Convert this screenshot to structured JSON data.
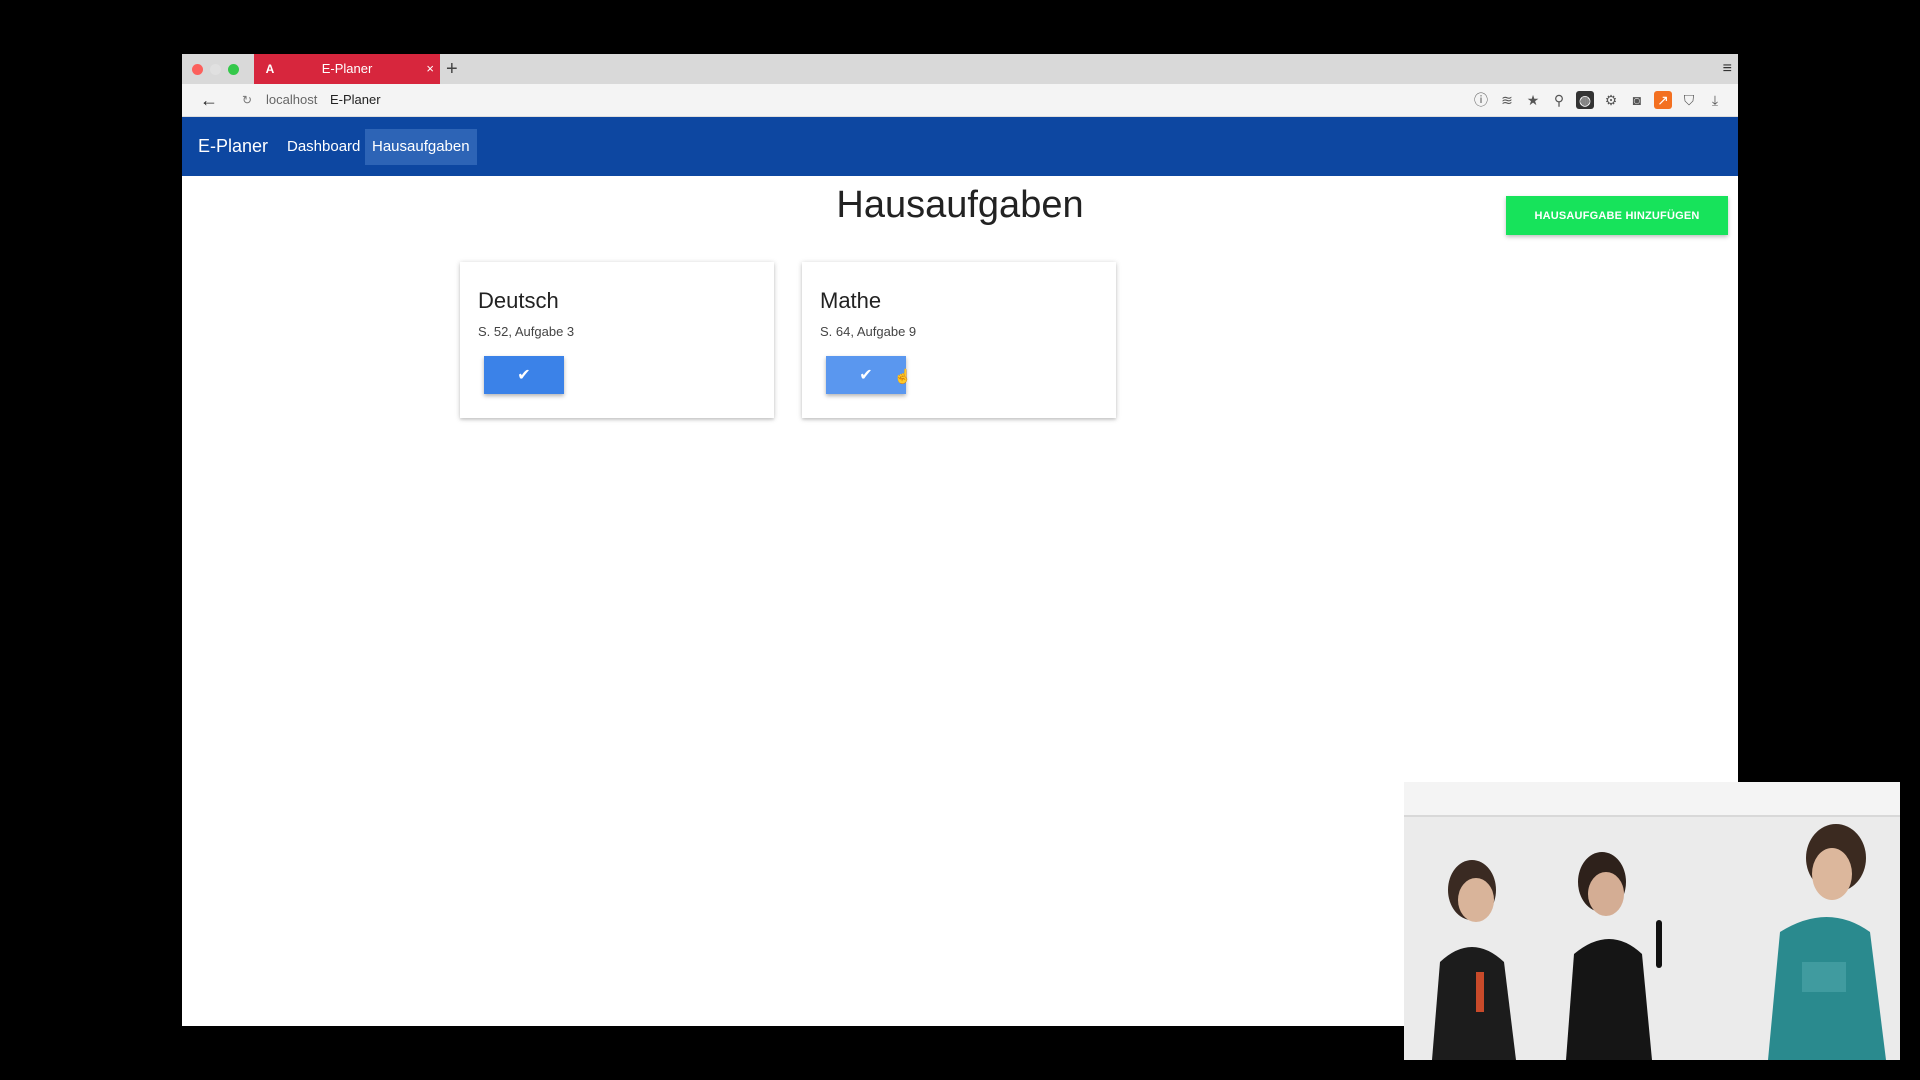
{
  "browser": {
    "tab_title": "E-Planer",
    "tab_close": "×",
    "tab_logo": "A",
    "new_tab": "+",
    "menu_icon": "≡",
    "back_icon": "←",
    "reload_icon": "↻",
    "url_host": "localhost",
    "url_title": "E-Planer",
    "extension_icons": [
      "info-icon",
      "wifi-icon",
      "star-icon",
      "search-icon",
      "ghost-icon",
      "gear-icon",
      "camera-icon",
      "chart-icon",
      "shield-icon",
      "download-icon"
    ]
  },
  "nav": {
    "brand": "E-Planer",
    "items": [
      {
        "label": "Dashboard",
        "active": false
      },
      {
        "label": "Hausaufgaben",
        "active": true
      }
    ],
    "color": "#0d47a1"
  },
  "main": {
    "title": "Hausaufgaben",
    "add_button": "HAUSAUFGABE HINZUFÜGEN",
    "add_button_color": "#17e35b",
    "cards": [
      {
        "subject": "Deutsch",
        "task": "S. 52, Aufgabe 3",
        "done_icon": "✔"
      },
      {
        "subject": "Mathe",
        "task": "S. 64, Aufgabe 9",
        "done_icon": "✔"
      }
    ],
    "done_button_color": "#3b82e8"
  }
}
